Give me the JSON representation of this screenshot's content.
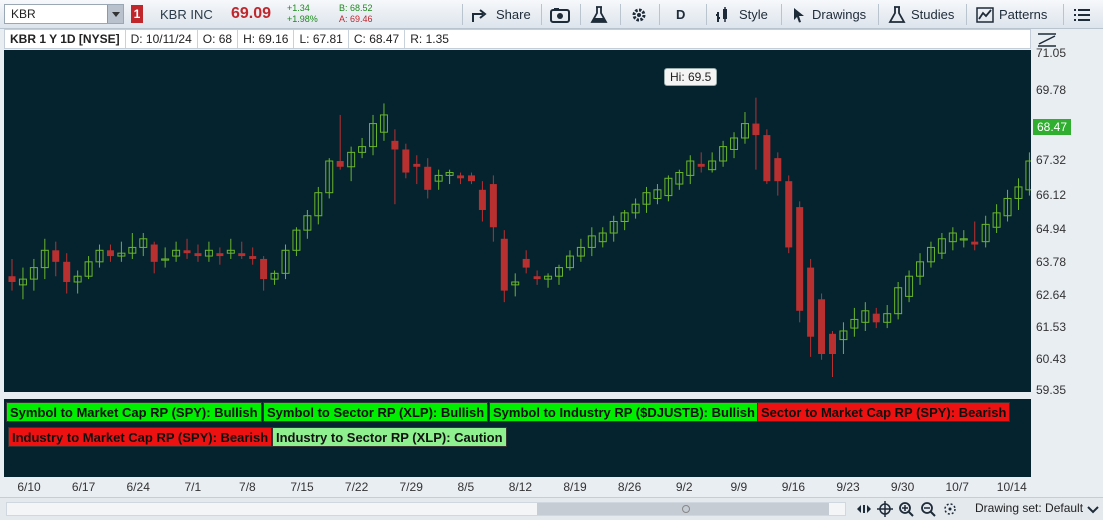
{
  "toolbar": {
    "symbol": "KBR",
    "alert_badge": "1",
    "company": "KBR INC",
    "price": "69.09",
    "change": "+1.34",
    "change_pct": "+1.98%",
    "bid": "B: 68.52",
    "ask": "A: 69.46",
    "share_label": "Share",
    "period_label": "D",
    "style_label": "Style",
    "drawings_label": "Drawings",
    "studies_label": "Studies",
    "patterns_label": "Patterns"
  },
  "info": {
    "title": "KBR 1 Y 1D [NYSE]",
    "date": "D: 10/11/24",
    "open": "O: 68",
    "high": "H: 69.16",
    "low": "L: 67.81",
    "close": "C: 68.47",
    "range": "R: 1.35"
  },
  "tooltip": "Hi: 69.5",
  "y_axis": {
    "labels": [
      "71.05",
      "69.78",
      "68.47",
      "67.32",
      "66.12",
      "64.94",
      "63.78",
      "62.64",
      "61.53",
      "60.43",
      "59.35"
    ],
    "last_price": "68.47"
  },
  "x_axis": {
    "labels": [
      "6/10",
      "6/17",
      "6/24",
      "7/1",
      "7/8",
      "7/15",
      "7/22",
      "7/29",
      "8/5",
      "8/12",
      "8/19",
      "8/26",
      "9/2",
      "9/9",
      "9/16",
      "9/23",
      "9/30",
      "10/7",
      "10/14"
    ]
  },
  "rp_labels": [
    {
      "text": "Symbol to Market Cap RP (SPY): Bullish",
      "status": "bullish"
    },
    {
      "text": "Symbol to Sector RP (XLP): Bullish",
      "status": "bullish"
    },
    {
      "text": "Symbol to Industry RP ($DJUSTB): Bullish",
      "status": "bullish"
    },
    {
      "text": "Sector to Market Cap RP (SPY): Bearish",
      "status": "bearish"
    },
    {
      "text": "Industry to Market Cap RP (SPY): Bearish",
      "status": "bearish"
    },
    {
      "text": "Industry to Sector RP (XLP): Caution",
      "status": "caution"
    }
  ],
  "colors": {
    "bull": "#6ab52a",
    "bear": "#b93030",
    "bg": "#05232f",
    "tag_bullish": "#00ee00",
    "tag_bearish": "#ee1111",
    "tag_caution": "#8ef08e"
  },
  "footer": {
    "drawing_set": "Drawing set: Default"
  },
  "chart_data": {
    "type": "candlestick",
    "ylim": [
      59.35,
      71.05
    ],
    "x_labels": [
      "6/10",
      "6/17",
      "6/24",
      "7/1",
      "7/8",
      "7/15",
      "7/22",
      "7/29",
      "8/5",
      "8/12",
      "8/19",
      "8/26",
      "9/2",
      "9/9",
      "9/16",
      "9/23",
      "9/30",
      "10/7",
      "10/14"
    ],
    "candles": [
      {
        "o": 63.3,
        "h": 63.9,
        "l": 62.8,
        "c": 63.1
      },
      {
        "o": 63.0,
        "h": 63.6,
        "l": 62.5,
        "c": 63.2
      },
      {
        "o": 63.2,
        "h": 63.9,
        "l": 62.8,
        "c": 63.6
      },
      {
        "o": 63.6,
        "h": 64.6,
        "l": 63.2,
        "c": 64.2
      },
      {
        "o": 64.2,
        "h": 64.5,
        "l": 63.3,
        "c": 63.8
      },
      {
        "o": 63.8,
        "h": 64.1,
        "l": 62.7,
        "c": 63.1
      },
      {
        "o": 63.1,
        "h": 63.5,
        "l": 62.7,
        "c": 63.3
      },
      {
        "o": 63.3,
        "h": 64.0,
        "l": 63.2,
        "c": 63.8
      },
      {
        "o": 63.8,
        "h": 64.4,
        "l": 63.6,
        "c": 64.2
      },
      {
        "o": 64.2,
        "h": 64.4,
        "l": 63.8,
        "c": 64.0
      },
      {
        "o": 64.0,
        "h": 64.5,
        "l": 63.8,
        "c": 64.1
      },
      {
        "o": 64.1,
        "h": 64.8,
        "l": 63.9,
        "c": 64.3
      },
      {
        "o": 64.3,
        "h": 64.8,
        "l": 64.0,
        "c": 64.6
      },
      {
        "o": 64.4,
        "h": 64.5,
        "l": 63.4,
        "c": 63.8
      },
      {
        "o": 63.9,
        "h": 64.3,
        "l": 63.6,
        "c": 63.9
      },
      {
        "o": 64.0,
        "h": 64.5,
        "l": 63.8,
        "c": 64.2
      },
      {
        "o": 64.2,
        "h": 64.6,
        "l": 63.9,
        "c": 64.1
      },
      {
        "o": 64.1,
        "h": 64.4,
        "l": 63.8,
        "c": 64.0
      },
      {
        "o": 64.0,
        "h": 64.5,
        "l": 63.8,
        "c": 64.2
      },
      {
        "o": 64.1,
        "h": 64.3,
        "l": 63.7,
        "c": 64.0
      },
      {
        "o": 64.1,
        "h": 64.6,
        "l": 63.9,
        "c": 64.2
      },
      {
        "o": 64.1,
        "h": 64.5,
        "l": 63.9,
        "c": 64.0
      },
      {
        "o": 64.0,
        "h": 64.3,
        "l": 63.7,
        "c": 63.9
      },
      {
        "o": 63.9,
        "h": 64.0,
        "l": 62.8,
        "c": 63.2
      },
      {
        "o": 63.2,
        "h": 63.5,
        "l": 63.0,
        "c": 63.4
      },
      {
        "o": 63.4,
        "h": 64.4,
        "l": 63.2,
        "c": 64.2
      },
      {
        "o": 64.2,
        "h": 65.0,
        "l": 64.0,
        "c": 64.9
      },
      {
        "o": 64.9,
        "h": 65.6,
        "l": 64.6,
        "c": 65.4
      },
      {
        "o": 65.4,
        "h": 66.4,
        "l": 65.1,
        "c": 66.2
      },
      {
        "o": 66.2,
        "h": 67.4,
        "l": 66.0,
        "c": 67.3
      },
      {
        "o": 67.3,
        "h": 68.9,
        "l": 67.0,
        "c": 67.1
      },
      {
        "o": 67.1,
        "h": 67.8,
        "l": 66.6,
        "c": 67.6
      },
      {
        "o": 67.6,
        "h": 68.1,
        "l": 67.4,
        "c": 67.8
      },
      {
        "o": 67.8,
        "h": 68.9,
        "l": 67.5,
        "c": 68.6
      },
      {
        "o": 68.3,
        "h": 69.3,
        "l": 68.0,
        "c": 68.9
      },
      {
        "o": 68.0,
        "h": 68.4,
        "l": 65.8,
        "c": 67.7
      },
      {
        "o": 67.7,
        "h": 67.9,
        "l": 66.7,
        "c": 66.9
      },
      {
        "o": 67.2,
        "h": 67.5,
        "l": 66.5,
        "c": 67.1
      },
      {
        "o": 67.1,
        "h": 67.4,
        "l": 66.0,
        "c": 66.3
      },
      {
        "o": 66.6,
        "h": 67.0,
        "l": 66.3,
        "c": 66.8
      },
      {
        "o": 66.8,
        "h": 67.0,
        "l": 66.5,
        "c": 66.9
      },
      {
        "o": 66.8,
        "h": 66.9,
        "l": 66.5,
        "c": 66.7
      },
      {
        "o": 66.8,
        "h": 66.9,
        "l": 66.5,
        "c": 66.6
      },
      {
        "o": 66.3,
        "h": 66.6,
        "l": 65.2,
        "c": 65.6
      },
      {
        "o": 66.5,
        "h": 66.8,
        "l": 64.5,
        "c": 65.0
      },
      {
        "o": 64.6,
        "h": 64.9,
        "l": 62.4,
        "c": 62.8
      },
      {
        "o": 63.0,
        "h": 63.4,
        "l": 62.6,
        "c": 63.1
      },
      {
        "o": 63.9,
        "h": 64.2,
        "l": 63.4,
        "c": 63.6
      },
      {
        "o": 63.3,
        "h": 63.5,
        "l": 63.0,
        "c": 63.2
      },
      {
        "o": 63.2,
        "h": 63.4,
        "l": 62.9,
        "c": 63.3
      },
      {
        "o": 63.3,
        "h": 63.7,
        "l": 63.0,
        "c": 63.6
      },
      {
        "o": 63.6,
        "h": 64.2,
        "l": 63.5,
        "c": 64.0
      },
      {
        "o": 64.0,
        "h": 64.6,
        "l": 63.8,
        "c": 64.3
      },
      {
        "o": 64.3,
        "h": 65.0,
        "l": 64.0,
        "c": 64.7
      },
      {
        "o": 64.5,
        "h": 65.0,
        "l": 64.3,
        "c": 64.8
      },
      {
        "o": 64.8,
        "h": 65.4,
        "l": 64.5,
        "c": 65.2
      },
      {
        "o": 65.2,
        "h": 65.6,
        "l": 64.9,
        "c": 65.5
      },
      {
        "o": 65.5,
        "h": 66.0,
        "l": 65.3,
        "c": 65.8
      },
      {
        "o": 65.8,
        "h": 66.4,
        "l": 65.5,
        "c": 66.2
      },
      {
        "o": 66.0,
        "h": 66.5,
        "l": 65.8,
        "c": 66.3
      },
      {
        "o": 66.1,
        "h": 66.8,
        "l": 65.9,
        "c": 66.7
      },
      {
        "o": 66.5,
        "h": 67.0,
        "l": 66.3,
        "c": 66.9
      },
      {
        "o": 66.8,
        "h": 67.5,
        "l": 66.5,
        "c": 67.3
      },
      {
        "o": 67.2,
        "h": 67.6,
        "l": 66.9,
        "c": 67.1
      },
      {
        "o": 67.0,
        "h": 67.6,
        "l": 66.9,
        "c": 67.3
      },
      {
        "o": 67.3,
        "h": 68.0,
        "l": 67.1,
        "c": 67.8
      },
      {
        "o": 67.7,
        "h": 68.3,
        "l": 67.4,
        "c": 68.1
      },
      {
        "o": 68.1,
        "h": 69.0,
        "l": 67.9,
        "c": 68.6
      },
      {
        "o": 68.6,
        "h": 69.5,
        "l": 67.0,
        "c": 68.2
      },
      {
        "o": 68.2,
        "h": 68.4,
        "l": 66.5,
        "c": 66.6
      },
      {
        "o": 67.4,
        "h": 67.6,
        "l": 66.1,
        "c": 66.6
      },
      {
        "o": 66.6,
        "h": 66.8,
        "l": 64.1,
        "c": 64.3
      },
      {
        "o": 65.7,
        "h": 65.9,
        "l": 61.7,
        "c": 62.1
      },
      {
        "o": 63.6,
        "h": 63.9,
        "l": 60.5,
        "c": 61.2
      },
      {
        "o": 62.5,
        "h": 62.7,
        "l": 60.4,
        "c": 60.6
      },
      {
        "o": 61.3,
        "h": 61.4,
        "l": 59.8,
        "c": 60.6
      },
      {
        "o": 61.1,
        "h": 61.7,
        "l": 60.6,
        "c": 61.4
      },
      {
        "o": 61.5,
        "h": 62.2,
        "l": 61.2,
        "c": 61.8
      },
      {
        "o": 61.7,
        "h": 62.4,
        "l": 61.4,
        "c": 62.1
      },
      {
        "o": 62.0,
        "h": 62.2,
        "l": 61.5,
        "c": 61.7
      },
      {
        "o": 61.7,
        "h": 62.3,
        "l": 61.5,
        "c": 62.0
      },
      {
        "o": 62.0,
        "h": 63.1,
        "l": 61.8,
        "c": 62.9
      },
      {
        "o": 62.6,
        "h": 63.5,
        "l": 62.4,
        "c": 63.3
      },
      {
        "o": 63.3,
        "h": 64.1,
        "l": 63.0,
        "c": 63.8
      },
      {
        "o": 63.8,
        "h": 64.5,
        "l": 63.6,
        "c": 64.3
      },
      {
        "o": 64.1,
        "h": 64.8,
        "l": 63.9,
        "c": 64.6
      },
      {
        "o": 64.5,
        "h": 65.0,
        "l": 64.2,
        "c": 64.8
      },
      {
        "o": 64.6,
        "h": 64.9,
        "l": 64.3,
        "c": 64.6
      },
      {
        "o": 64.5,
        "h": 65.2,
        "l": 64.2,
        "c": 64.4
      },
      {
        "o": 64.5,
        "h": 65.4,
        "l": 64.3,
        "c": 65.1
      },
      {
        "o": 65.0,
        "h": 65.8,
        "l": 64.8,
        "c": 65.5
      },
      {
        "o": 65.4,
        "h": 66.3,
        "l": 65.2,
        "c": 66.0
      },
      {
        "o": 66.0,
        "h": 66.7,
        "l": 65.6,
        "c": 66.4
      },
      {
        "o": 66.3,
        "h": 67.6,
        "l": 66.1,
        "c": 67.3
      },
      {
        "o": 67.1,
        "h": 68.4,
        "l": 66.9,
        "c": 68.1
      },
      {
        "o": 67.7,
        "h": 68.7,
        "l": 67.6,
        "c": 68.3
      },
      {
        "o": 68.0,
        "h": 68.9,
        "l": 67.8,
        "c": 68.6
      },
      {
        "o": 68.6,
        "h": 69.1,
        "l": 67.9,
        "c": 68.2
      },
      {
        "o": 68.3,
        "h": 68.5,
        "l": 67.6,
        "c": 67.9
      },
      {
        "o": 68.0,
        "h": 69.16,
        "l": 67.81,
        "c": 68.47
      }
    ],
    "title": "KBR 1 Y 1D [NYSE]",
    "grid": false
  }
}
